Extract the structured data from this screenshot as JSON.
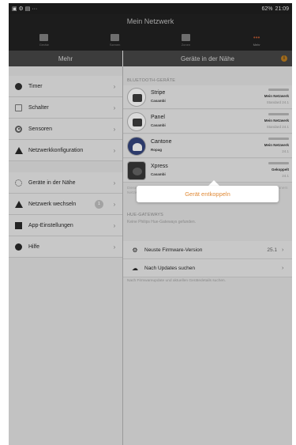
{
  "statusbar": {
    "left_icons": "▣ ⚙ ▤ ···",
    "battery": "62%",
    "time": "21:09"
  },
  "app": {
    "title": "Mein Netzwerk"
  },
  "tabs": [
    {
      "label": "Geräte"
    },
    {
      "label": "Szenen"
    },
    {
      "label": "Zonen"
    },
    {
      "label": "Mehr"
    }
  ],
  "sidebar": {
    "header": "Mehr",
    "items": [
      {
        "label": "Timer",
        "icon": "clock-icon"
      },
      {
        "label": "Schalter",
        "icon": "switch-icon"
      },
      {
        "label": "Sensoren",
        "icon": "sensor-icon"
      },
      {
        "label": "Netzwerkkonfiguration",
        "icon": "network-icon"
      },
      {
        "label": "Geräte in der Nähe",
        "icon": "nearby-icon"
      },
      {
        "label": "Netzwerk wechseln",
        "icon": "network-icon",
        "badge": "1"
      },
      {
        "label": "App-Einstellungen",
        "icon": "settings-icon"
      },
      {
        "label": "Hilfe",
        "icon": "help-icon"
      }
    ]
  },
  "detail": {
    "header": "Geräte in der Nähe",
    "bluetooth_label": "BLUETOOTH-GERÄTE",
    "devices": [
      {
        "name": "Stripe",
        "maker": "Casambi",
        "status": "Mein Netzwerk",
        "std": "Standard 24.1"
      },
      {
        "name": "Panel",
        "maker": "Casambi",
        "status": "Mein Netzwerk",
        "std": "Standard 24.1"
      },
      {
        "name": "Cantone",
        "maker": "Ropag",
        "status": "Mein Netzwerk",
        "std": "24.1"
      },
      {
        "name": "Xpress",
        "maker": "Casambi",
        "status": "Gekoppelt",
        "std": "24.1"
      }
    ],
    "hidden_text": "Diese Liste beinhaltet alle in der Nähe befindlichen Bluetooth-Geräte. Geräte können aus einem Netzwerk entkoppelt werden, indem sie die Firmware-Version ...",
    "popover_action": "Gerät entkoppeln",
    "hue_label": "HUE-GATEWAYS",
    "hue_note": "Keine Philips Hue-Gateways gefunden.",
    "firmware_label": "Neuste Firmware-Version",
    "firmware_value": "25.1",
    "updates_label": "Nach Updates suchen",
    "foot_note": "Nach Firmwareupdate und aktuellen Gerätedetails suchen."
  }
}
